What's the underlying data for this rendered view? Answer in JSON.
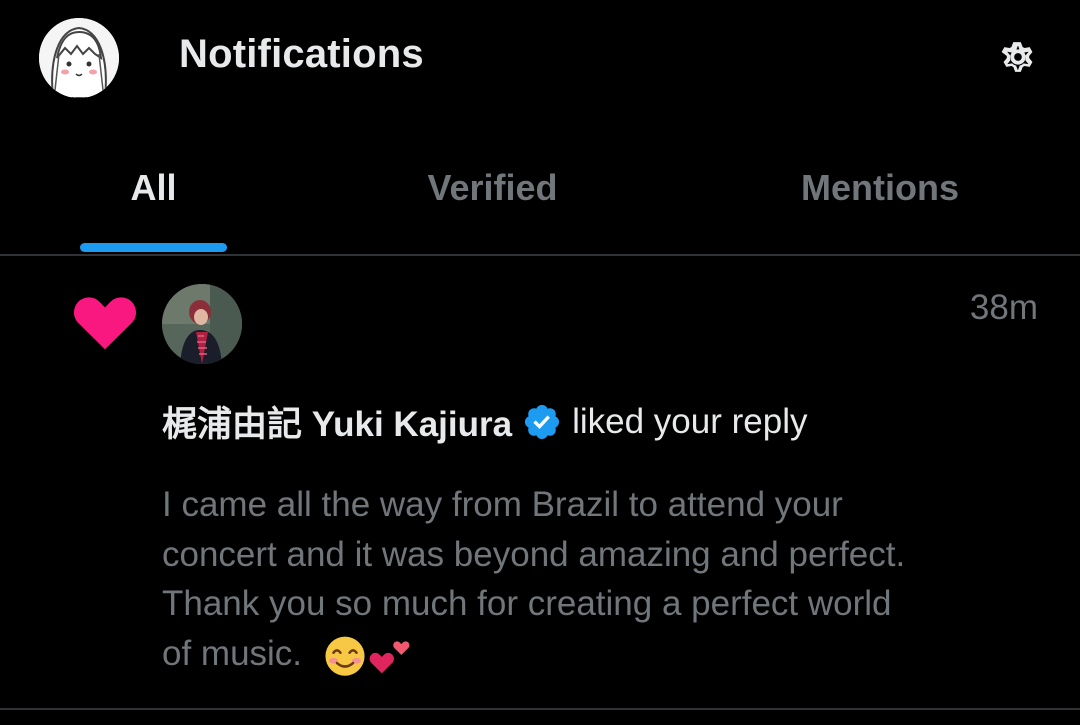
{
  "header": {
    "title": "Notifications",
    "profile_avatar_icon": "profile-avatar-icon",
    "settings_icon": "gear-icon"
  },
  "tabs": [
    {
      "label": "All",
      "active": true
    },
    {
      "label": "Verified",
      "active": false
    },
    {
      "label": "Mentions",
      "active": false
    }
  ],
  "colors": {
    "accent": "#1d9bf0",
    "heart": "#f91880",
    "muted": "#71767b",
    "text": "#e7e9ea",
    "background": "#000000"
  },
  "notification": {
    "type_icon": "heart-icon",
    "time": "38m",
    "user_name": "梶浦由記 Yuki Kajiura",
    "verified_icon": "verified-badge-icon",
    "action": "liked your reply",
    "text": "I came all the way from Brazil to attend your concert and it was beyond amazing and perfect. Thank you so much for creating a perfect world of music.",
    "emojis": [
      "smiling-face-icon",
      "two-hearts-icon"
    ]
  }
}
